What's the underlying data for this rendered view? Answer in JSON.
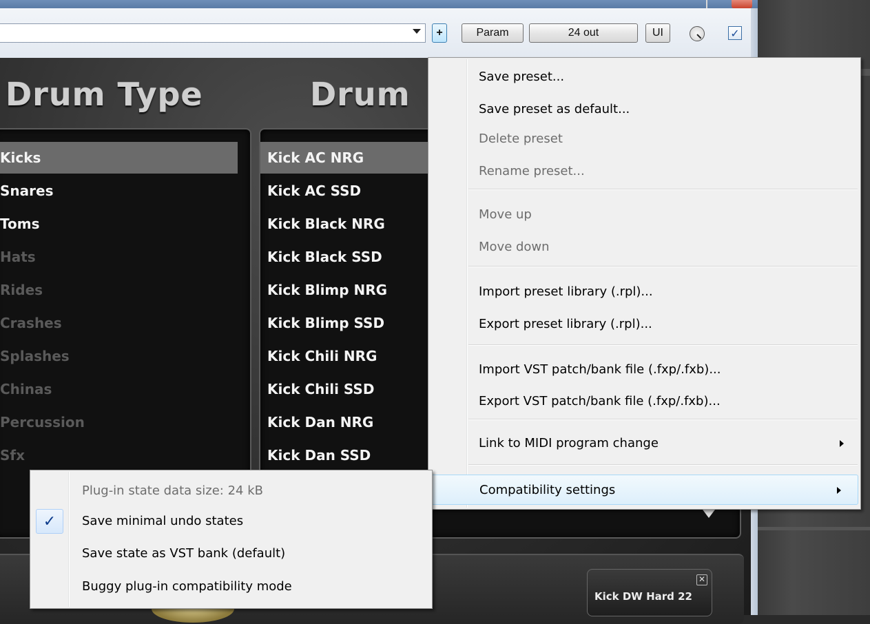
{
  "toolbar": {
    "add_label": "+",
    "param_label": "Param",
    "outputs_label": "24 out",
    "ui_label": "UI",
    "enabled_check": "✓"
  },
  "plugin": {
    "drum_type_heading": "Drum Type",
    "drum_model_heading": "Drum",
    "drum_types": [
      {
        "label": "Kicks",
        "state": "selected"
      },
      {
        "label": "Snares",
        "state": "normal"
      },
      {
        "label": "Toms",
        "state": "normal"
      },
      {
        "label": "Hats",
        "state": "dim"
      },
      {
        "label": "Rides",
        "state": "dim"
      },
      {
        "label": "Crashes",
        "state": "dim"
      },
      {
        "label": "Splashes",
        "state": "dim"
      },
      {
        "label": "Chinas",
        "state": "dim"
      },
      {
        "label": "Percussion",
        "state": "dim"
      },
      {
        "label": "Sfx",
        "state": "dim"
      }
    ],
    "drum_models": [
      {
        "label": "Kick AC NRG",
        "state": "selected"
      },
      {
        "label": "Kick AC SSD",
        "state": "normal"
      },
      {
        "label": "Kick Black NRG",
        "state": "normal"
      },
      {
        "label": "Kick Black SSD",
        "state": "normal"
      },
      {
        "label": "Kick Blimp NRG",
        "state": "normal"
      },
      {
        "label": "Kick Blimp SSD",
        "state": "normal"
      },
      {
        "label": "Kick Chili NRG",
        "state": "normal"
      },
      {
        "label": "Kick Chili SSD",
        "state": "normal"
      },
      {
        "label": "Kick Dan NRG",
        "state": "normal"
      },
      {
        "label": "Kick Dan SSD",
        "state": "normal"
      }
    ],
    "thumbnail_label": "Kick DW Hard 22"
  },
  "preset_menu": {
    "items": [
      {
        "label": "Save preset...",
        "disabled": false
      },
      {
        "label": "Save preset as default...",
        "disabled": false
      },
      {
        "label": "Delete preset",
        "disabled": true
      },
      {
        "label": "Rename preset...",
        "disabled": true
      },
      {
        "label": "Move up",
        "disabled": true
      },
      {
        "label": "Move down",
        "disabled": true
      },
      {
        "label": "Import preset library (.rpl)...",
        "disabled": false
      },
      {
        "label": "Export preset library (.rpl)...",
        "disabled": false
      },
      {
        "label": "Import VST patch/bank file (.fxp/.fxb)...",
        "disabled": false
      },
      {
        "label": "Export VST patch/bank file (.fxp/.fxb)...",
        "disabled": false
      },
      {
        "label": "Link to MIDI program change",
        "disabled": false,
        "submenu": true
      },
      {
        "label": "Compatibility settings",
        "disabled": false,
        "submenu": true,
        "highlighted": true
      }
    ]
  },
  "compat_menu": {
    "items": [
      {
        "label": "Plug-in state data size:  24 kB",
        "disabled": true,
        "checked": false
      },
      {
        "label": "Save minimal undo states",
        "disabled": false,
        "checked": true
      },
      {
        "label": "Save state as VST bank (default)",
        "disabled": false,
        "checked": false
      },
      {
        "label": "Buggy plug-in compatibility mode",
        "disabled": false,
        "checked": false
      }
    ],
    "check_glyph": "✓"
  }
}
